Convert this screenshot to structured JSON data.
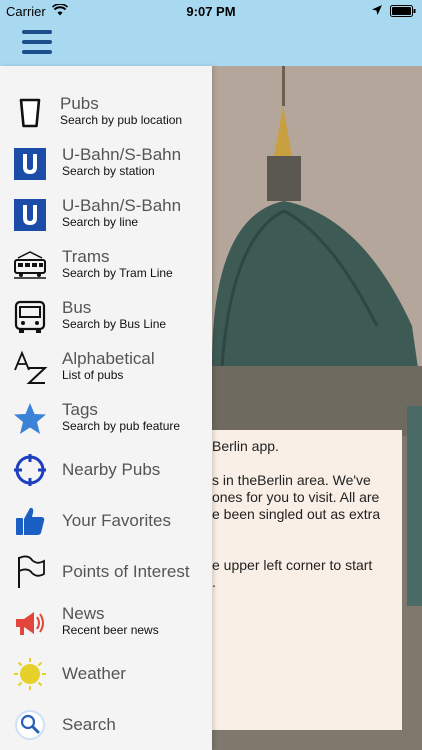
{
  "status_bar": {
    "carrier": "Carrier",
    "time": "9:07 PM"
  },
  "colors": {
    "topbar": "#a9d9f1",
    "hamburger": "#1d4f8c",
    "ubahn_blue": "#1b4da8",
    "star_blue": "#3a83d6"
  },
  "menu": {
    "items": [
      {
        "icon": "pint-glass-icon",
        "title": "Pubs",
        "subtitle": "Search by pub location"
      },
      {
        "icon": "u-bahn-icon",
        "title": "U-Bahn/S-Bahn",
        "subtitle": "Search by station"
      },
      {
        "icon": "u-bahn-icon",
        "title": "U-Bahn/S-Bahn",
        "subtitle": "Search by line"
      },
      {
        "icon": "tram-icon",
        "title": "Trams",
        "subtitle": "Search by Tram Line"
      },
      {
        "icon": "bus-icon",
        "title": "Bus",
        "subtitle": "Search by Bus Line"
      },
      {
        "icon": "az-icon",
        "title": "Alphabetical",
        "subtitle": "List of pubs"
      },
      {
        "icon": "star-icon",
        "title": "Tags",
        "subtitle": "Search by pub feature"
      },
      {
        "icon": "crosshair-icon",
        "title": "Nearby Pubs"
      },
      {
        "icon": "thumbs-up-icon",
        "title": "Your Favorites"
      },
      {
        "icon": "flag-icon",
        "title": "Points of Interest"
      },
      {
        "icon": "megaphone-icon",
        "title": "News",
        "subtitle": "Recent beer news"
      },
      {
        "icon": "sun-icon",
        "title": "Weather"
      },
      {
        "icon": "magnifier-icon",
        "title": "Search"
      }
    ]
  },
  "welcome": {
    "line1": "Berlin app.",
    "line2": "s in theBerlin area. We've",
    "line3": "ones for you to visit. All are",
    "line4": "e been singled out as extra",
    "line5": "e upper left corner to start",
    "line6": "."
  }
}
